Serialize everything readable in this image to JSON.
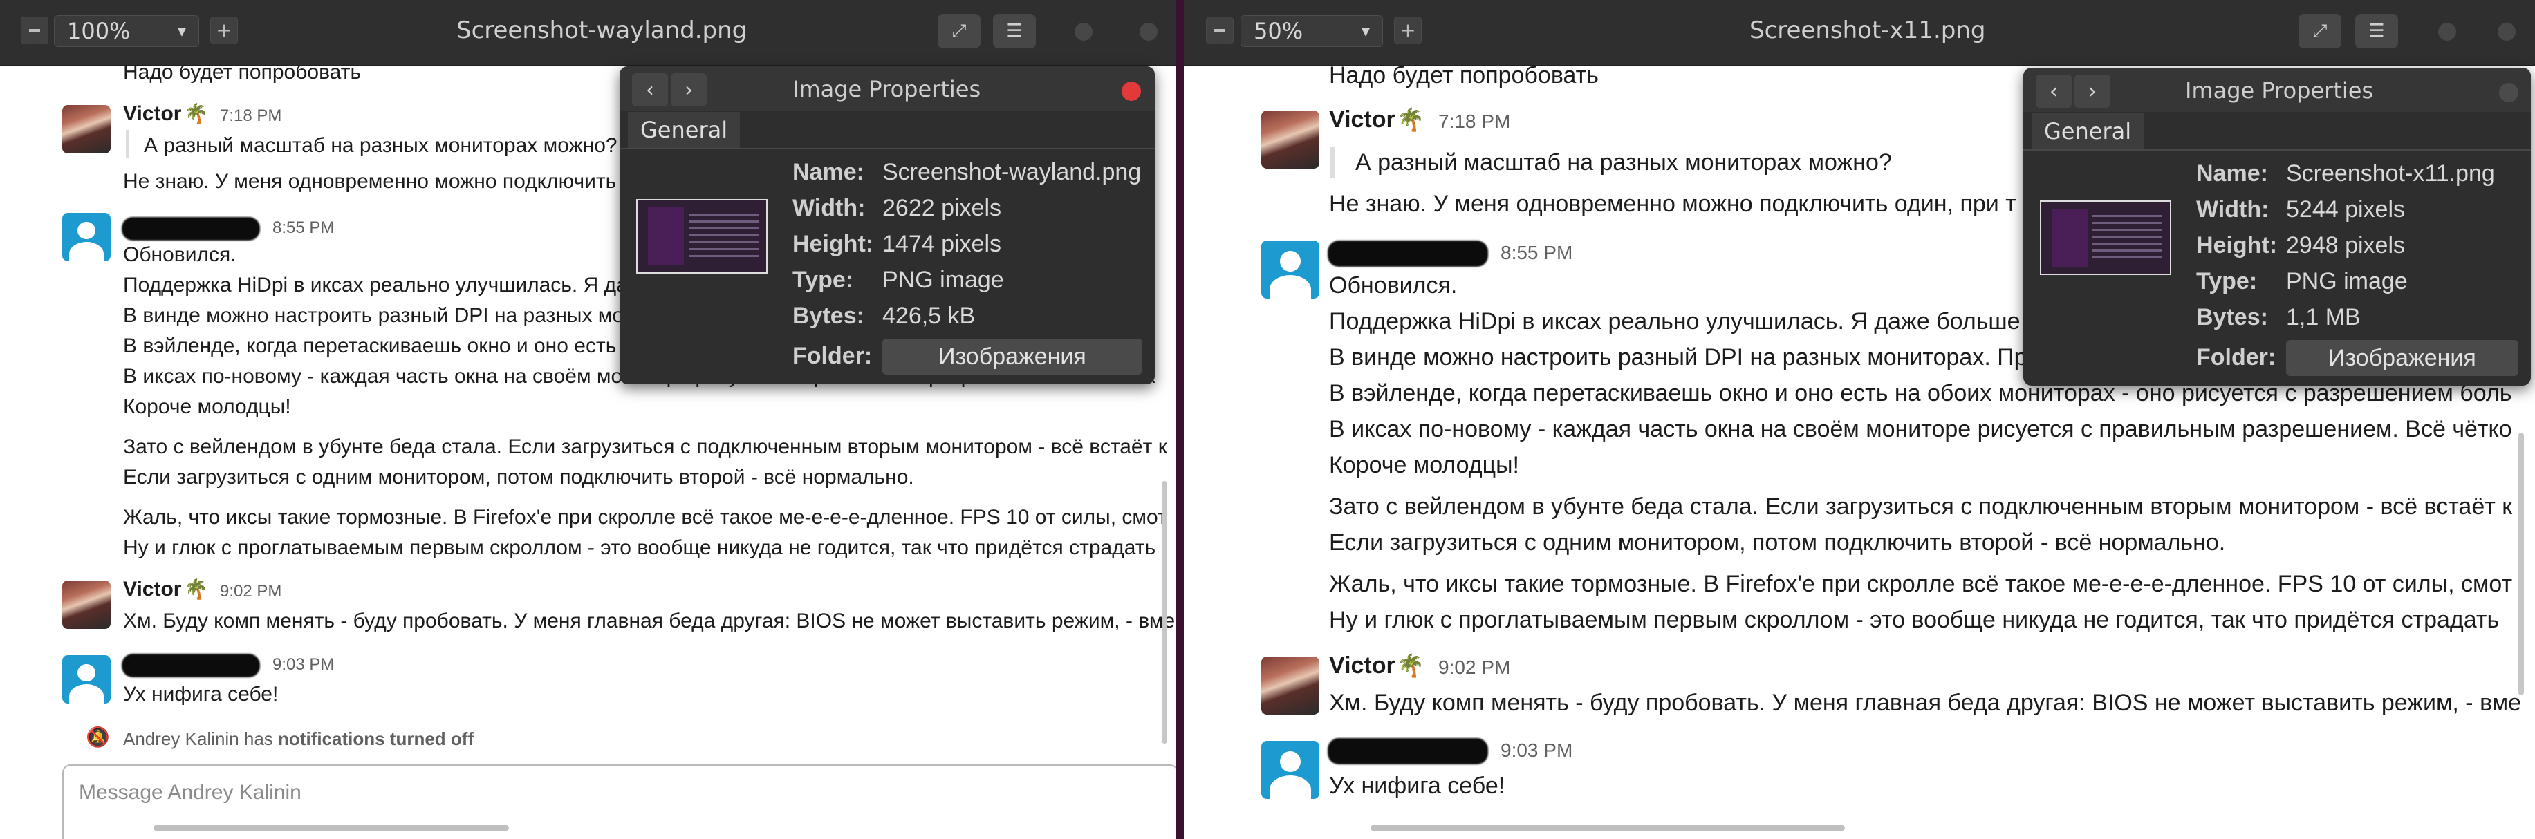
{
  "left": {
    "zoom": "100%",
    "title": "Screenshot-wayland.png",
    "messages": {
      "prev_line": "Надо будет попробовать",
      "victor1": {
        "name": "Victor",
        "emoji": "🌴",
        "time": "7:18 PM",
        "quote": "А разный масштаб на разных мониторах можно?",
        "line": "Не знаю. У меня одновременно можно подключить"
      },
      "andrey1": {
        "time": "8:55 PM",
        "lines": [
          "Обновился.",
          "Поддержка HiDpi в иксах реально улучшилась. Я да",
          "В винде можно настроить разный DPI на разных мо",
          "В вэйленде, когда перетаскиваешь окно и оно есть",
          "В иксах по-новому - каждая часть окна на своём мониторе рисуется с правильным разрешением. Всё чётк",
          "Короче молодцы!",
          "Зато с вейлендом в убунте беда стала. Если загрузиться с подключенным вторым монитором - всё встаёт к",
          "Если загрузиться с одним монитором, потом подключить второй - всё нормально.",
          "Жаль, что иксы такие тормозные. В Firefox'е при скролле всё такое ме-е-е-е-дленное. FPS 10 от силы, смот",
          "Ну и глюк с проглатываемым первым скроллом - это вообще никуда не годится, так что придётся страдать"
        ]
      },
      "victor2": {
        "name": "Victor",
        "emoji": "🌴",
        "time": "9:02 PM",
        "line": "Хм. Буду комп менять - буду пробовать. У меня главная беда другая: BIOS не может выставить режим, - вме"
      },
      "andrey2": {
        "time": "9:03 PM",
        "line": "Ух нифига себе!"
      },
      "notice_prefix": "Andrey Kalinin has ",
      "notice_bold": "notifications turned off",
      "composer_placeholder": "Message Andrey Kalinin"
    },
    "props": {
      "title": "Image Properties",
      "tab": "General",
      "name_label": "Name:",
      "name_value": "Screenshot-wayland.png",
      "width_label": "Width:",
      "width_value": "2622 pixels",
      "height_label": "Height:",
      "height_value": "1474 pixels",
      "type_label": "Type:",
      "type_value": "PNG image",
      "bytes_label": "Bytes:",
      "bytes_value": "426,5 kB",
      "folder_label": "Folder:",
      "folder_value": "Изображения"
    }
  },
  "right": {
    "zoom": "50%",
    "title": "Screenshot-x11.png",
    "messages": {
      "prev_line": "Надо будет попробовать",
      "victor1": {
        "name": "Victor",
        "emoji": "🌴",
        "time": "7:18 PM",
        "quote": "А разный масштаб на разных мониторах можно?",
        "line": "Не знаю. У меня одновременно можно подключить один, при т"
      },
      "andrey1": {
        "time": "8:55 PM",
        "lines": [
          "Обновился.",
          "Поддержка HiDpi в иксах реально улучшилась. Я даже больше",
          "В винде можно настроить разный DPI на разных мониторах. Пр",
          "В вэйленде, когда перетаскиваешь окно и оно есть на обоих мониторах - оно рисуется с разрешением боль",
          "В иксах по-новому - каждая часть окна на своём мониторе рисуется с правильным разрешением. Всё чётко",
          "Короче молодцы!",
          "Зато с вейлендом в убунте беда стала. Если загрузиться с подключенным вторым монитором - всё встаёт к",
          "Если загрузиться с одним монитором, потом подключить второй - всё нормально.",
          "Жаль, что иксы такие тормозные. В Firefox'е при скролле всё такое ме-е-е-е-дленное. FPS 10 от силы, смот",
          "Ну и глюк с проглатываемым первым скроллом - это вообще никуда не годится, так что придётся страдать"
        ]
      },
      "victor2": {
        "name": "Victor",
        "emoji": "🌴",
        "time": "9:02 PM",
        "line": "Хм. Буду комп менять - буду пробовать. У меня главная беда другая: BIOS не может выставить режим, - вме"
      },
      "andrey2": {
        "time": "9:03 PM",
        "line": "Ух нифига себе!"
      }
    },
    "props": {
      "title": "Image Properties",
      "tab": "General",
      "name_label": "Name:",
      "name_value": "Screenshot-x11.png",
      "width_label": "Width:",
      "width_value": "5244 pixels",
      "height_label": "Height:",
      "height_value": "2948 pixels",
      "type_label": "Type:",
      "type_value": "PNG image",
      "bytes_label": "Bytes:",
      "bytes_value": "1,1 MB",
      "folder_label": "Folder:",
      "folder_value": "Изображения"
    }
  },
  "icons": {
    "zoom_out": "minus-icon",
    "zoom_in": "plus-icon",
    "fit": "fullscreen-icon",
    "menu": "hamburger-icon",
    "back": "chevron-left-icon",
    "forward": "chevron-right-icon",
    "notification": "bell-off-icon"
  },
  "colors": {
    "accent_close": "#e23a3a",
    "avatar_default": "#1d9bd1",
    "text": "#1d1c1d"
  }
}
